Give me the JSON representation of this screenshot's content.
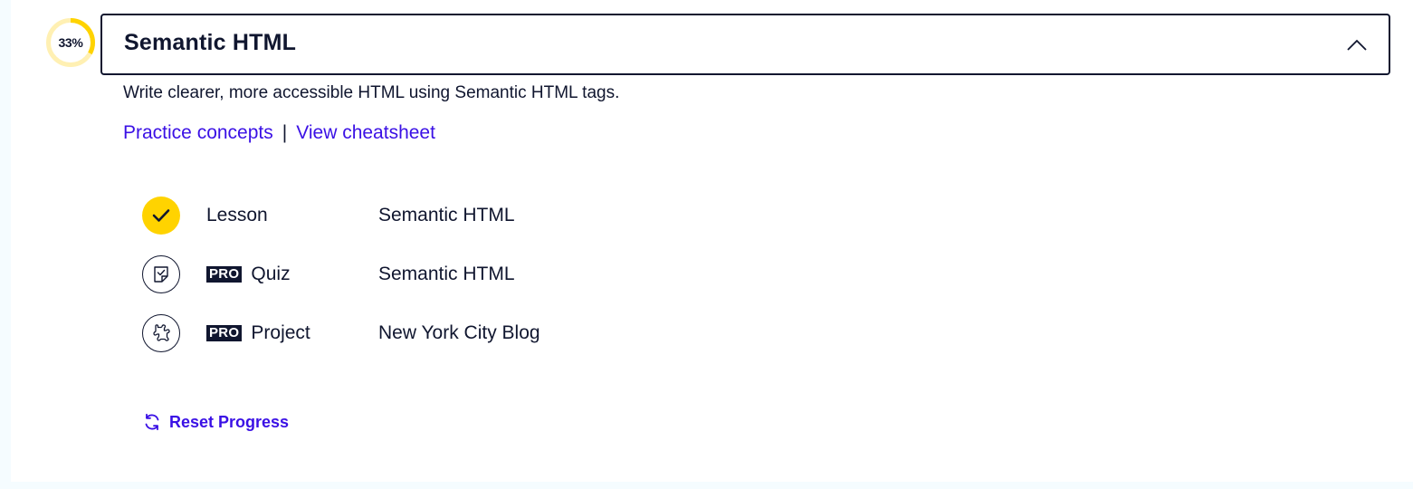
{
  "module": {
    "progress_percent": 33,
    "progress_label": "33%",
    "title": "Semantic HTML",
    "expanded": true,
    "description": "Write clearer, more accessible HTML using Semantic HTML tags.",
    "links": {
      "practice": "Practice concepts",
      "separator": "|",
      "cheatsheet": "View cheatsheet"
    },
    "items": [
      {
        "type": "Lesson",
        "name": "Semantic HTML",
        "pro": false,
        "completed": true,
        "icon": "check-icon"
      },
      {
        "type": "Quiz",
        "name": "Semantic HTML",
        "pro": true,
        "badge": "PRO",
        "completed": false,
        "icon": "quiz-icon"
      },
      {
        "type": "Project",
        "name": "New York City Blog",
        "pro": true,
        "badge": "PRO",
        "completed": false,
        "icon": "puzzle-icon"
      }
    ],
    "reset_label": "Reset Progress"
  },
  "colors": {
    "ink": "#10162f",
    "link": "#3a10e5",
    "accent_yellow": "#ffd300",
    "ring_track": "#fff0b3",
    "page_bg": "#f5fcff"
  }
}
